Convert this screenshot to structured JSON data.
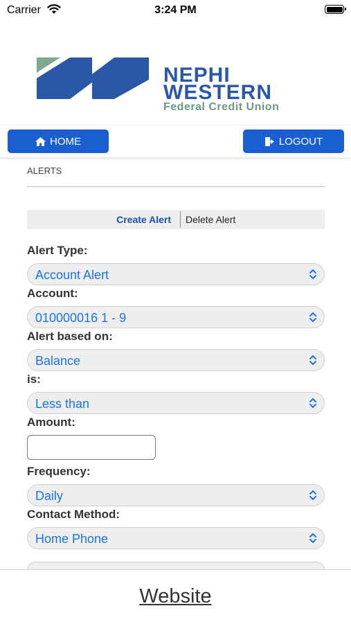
{
  "status_bar": {
    "carrier": "Carrier",
    "time": "3:24 PM"
  },
  "logo": {
    "line1": "NEPHI",
    "line2": "WESTERN",
    "line3": "Federal Credit Union"
  },
  "nav": {
    "home_label": "HOME",
    "logout_label": "LOGOUT"
  },
  "page": {
    "title": "ALERTS"
  },
  "tabs": {
    "create": "Create Alert",
    "delete": "Delete Alert"
  },
  "form": {
    "alert_type_label": "Alert Type:",
    "alert_type_value": "Account Alert",
    "account_label": "Account:",
    "account_value": "010000016 1 - 9",
    "based_on_label": "Alert based on:",
    "based_on_value": "Balance",
    "is_label": "is:",
    "is_value": "Less than",
    "amount_label": "Amount:",
    "amount_value": "",
    "frequency_label": "Frequency:",
    "frequency_value": "Daily",
    "contact_label": "Contact Method:",
    "contact_value": "Home Phone"
  },
  "footer": {
    "link": "Website"
  },
  "colors": {
    "brand_blue": "#1a5fd1",
    "logo_blue": "#2b57a9",
    "logo_green": "#6b9a7c",
    "select_text": "#1a73e8"
  }
}
